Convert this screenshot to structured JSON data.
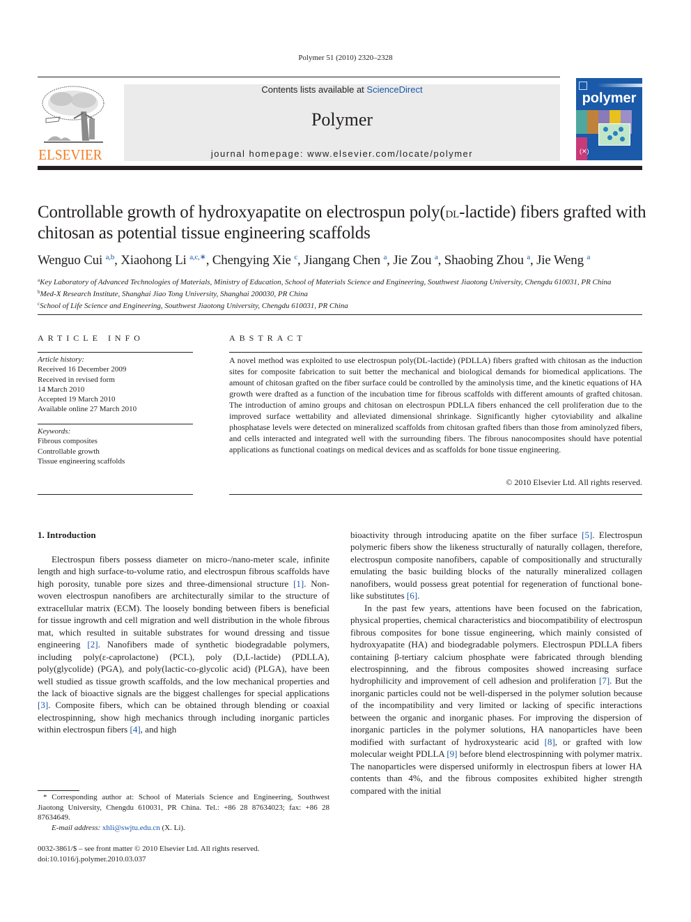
{
  "header": {
    "citation": "Polymer 51 (2010) 2320–2328",
    "contents_prefix": "Contents lists available at ",
    "contents_link": "ScienceDirect",
    "journal_name": "Polymer",
    "homepage": "journal homepage: www.elsevier.com/locate/polymer",
    "publisher_logo_text": "ELSEVIER",
    "cover_title": "polymer",
    "colors": {
      "elsevier_orange": "#f47b20",
      "link_blue": "#1a57a8",
      "cover_blue": "#1a5aa8",
      "banner_gray": "#ebebeb"
    }
  },
  "article": {
    "title_part1": "Controllable growth of hydroxyapatite on electrospun poly(",
    "title_sc": "dl",
    "title_part2": "-lactide) fibers grafted with chitosan as potential tissue engineering scaffolds",
    "authors": [
      {
        "name": "Wenguo Cui",
        "sup": "a,b",
        "sep": ", "
      },
      {
        "name": "Xiaohong Li",
        "sup": "a,c,∗",
        "sep": ", "
      },
      {
        "name": "Chengying Xie",
        "sup": "c",
        "sep": ", "
      },
      {
        "name": "Jiangang Chen",
        "sup": "a",
        "sep": ", "
      },
      {
        "name": "Jie Zou",
        "sup": "a",
        "sep": ", "
      },
      {
        "name": "Shaobing Zhou",
        "sup": "a",
        "sep": ", "
      },
      {
        "name": "Jie Weng",
        "sup": "a",
        "sep": ""
      }
    ],
    "affiliations": [
      {
        "mark": "a",
        "text": "Key Laboratory of Advanced Technologies of Materials, Ministry of Education, School of Materials Science and Engineering, Southwest Jiaotong University, Chengdu 610031, PR China"
      },
      {
        "mark": "b",
        "text": "Med-X Research Institute, Shanghai Jiao Tong University, Shanghai 200030, PR China"
      },
      {
        "mark": "c",
        "text": "School of Life Science and Engineering, Southwest Jiaotong University, Chengdu 610031, PR China"
      }
    ]
  },
  "article_info": {
    "heading": "ARTICLE INFO",
    "history_label": "Article history:",
    "history": [
      "Received 16 December 2009",
      "Received in revised form",
      "14 March 2010",
      "Accepted 19 March 2010",
      "Available online 27 March 2010"
    ],
    "keywords_label": "Keywords:",
    "keywords": [
      "Fibrous composites",
      "Controllable growth",
      "Tissue engineering scaffolds"
    ]
  },
  "abstract": {
    "heading": "ABSTRACT",
    "text": "A novel method was exploited to use electrospun poly(DL-lactide) (PDLLA) fibers grafted with chitosan as the induction sites for composite fabrication to suit better the mechanical and biological demands for biomedical applications. The amount of chitosan grafted on the fiber surface could be controlled by the aminolysis time, and the kinetic equations of HA growth were drafted as a function of the incubation time for fibrous scaffolds with different amounts of grafted chitosan. The introduction of amino groups and chitosan on electrospun PDLLA fibers enhanced the cell proliferation due to the improved surface wettability and alleviated dimensional shrinkage. Significantly higher cytoviability and alkaline phosphatase levels were detected on mineralized scaffolds from chitosan grafted fibers than those from aminolyzed fibers, and cells interacted and integrated well with the surrounding fibers. The fibrous nanocomposites should have potential applications as functional coatings on medical devices and as scaffolds for bone tissue engineering.",
    "copyright": "© 2010 Elsevier Ltd. All rights reserved."
  },
  "body": {
    "section_heading": "1.  Introduction",
    "left": {
      "p1_a": "Electrospun fibers possess diameter on micro-/nano-meter scale, infinite length and high surface-to-volume ratio, and electrospun fibrous scaffolds have high porosity, tunable pore sizes and three-dimensional structure ",
      "ref1": "[1]",
      "p1_b": ". Non-woven electrospun nanofibers are architecturally similar to the structure of extracellular matrix (ECM). The loosely bonding between fibers is beneficial for tissue ingrowth and cell migration and well distribution in the whole fibrous mat, which resulted in suitable substrates for wound dressing and tissue engineering ",
      "ref2": "[2]",
      "p1_c": ". Nanofibers made of synthetic biodegradable polymers, including poly(ε-caprolactone) (PCL), poly (D,L-lactide) (PDLLA), poly(glycolide) (PGA), and poly(lactic-co-glycolic acid) (PLGA), have been well studied as tissue growth scaffolds, and the low mechanical properties and the lack of bioactive signals are the biggest challenges for special applications ",
      "ref3": "[3]",
      "p1_d": ". Composite fibers, which can be obtained through blending or coaxial electrospinning, show high mechanics through including inorganic particles within electrospun fibers ",
      "ref4": "[4]",
      "p1_e": ", and high"
    },
    "right": {
      "p1_a": "bioactivity through introducing apatite on the fiber surface ",
      "ref5": "[5]",
      "p1_b": ". Electrospun polymeric fibers show the likeness structurally of naturally collagen, therefore, electrospun composite nanofibers, capable of compositionally and structurally emulating the basic building blocks of the naturally mineralized collagen nanofibers, would possess great potential for regeneration of functional bone-like substitutes ",
      "ref6": "[6]",
      "p1_c": ".",
      "p2_a": "In the past few years, attentions have been focused on the fabrication, physical properties, chemical characteristics and biocompatibility of electrospun fibrous composites for bone tissue engineering, which mainly consisted of hydroxyapatite (HA) and biodegradable polymers. Electrospun PDLLA fibers containing β-tertiary calcium phosphate were fabricated through blending electrospinning, and the fibrous composites showed increasing surface hydrophilicity and improvement of cell adhesion and proliferation ",
      "ref7": "[7]",
      "p2_b": ". But the inorganic particles could not be well-dispersed in the polymer solution because of the incompatibility and very limited or lacking of specific interactions between the organic and inorganic phases. For improving the dispersion of inorganic particles in the polymer solutions, HA nanoparticles have been modified with surfactant of hydroxystearic acid ",
      "ref8": "[8]",
      "p2_c": ", or grafted with low molecular weight PDLLA ",
      "ref9": "[9]",
      "p2_d": " before blend electrospinning with polymer matrix. The nanoparticles were dispersed uniformly in electrospun fibers at lower HA contents than 4%, and the fibrous composites exhibited higher strength compared with the initial"
    }
  },
  "footnote": {
    "corresponding": "* Corresponding author at: School of Materials Science and Engineering, Southwest Jiaotong University, Chengdu 610031, PR China. Tel.: +86 28 87634023; fax: +86 28 87634649.",
    "email_label": "E-mail address: ",
    "email": "xhli@swjtu.edu.cn",
    "email_suffix": " (X. Li).",
    "issn": "0032-3861/$ – see front matter © 2010 Elsevier Ltd. All rights reserved.",
    "doi": "doi:10.1016/j.polymer.2010.03.037"
  }
}
